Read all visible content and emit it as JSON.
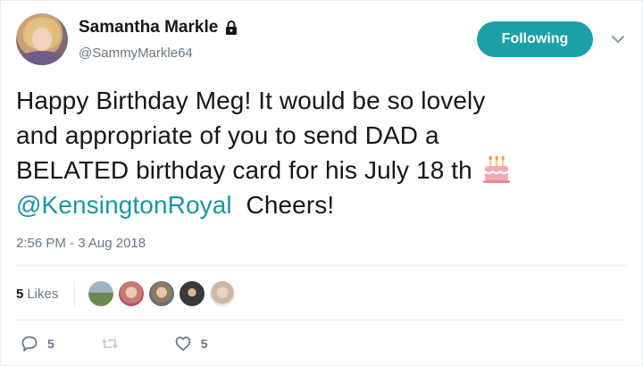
{
  "author": {
    "display_name": "Samantha Markle",
    "handle": "@SammyMarkle64",
    "protected_icon": "lock-icon"
  },
  "follow_button": {
    "label": "Following",
    "color": "#1da1a8"
  },
  "menu": {
    "icon": "chevron-down-icon"
  },
  "tweet": {
    "line1": "Happy Birthday Meg! It would be so lovely",
    "line2": "and appropriate of you to send DAD a",
    "line3": "BELATED birthday card for his July 18 th",
    "mention": "@KensingtonRoyal",
    "line4_rest": "  Cheers!",
    "emoji_icon": "birthday-cake-icon",
    "mention_color": "#1b95a5"
  },
  "timestamp": "2:56 PM - 3 Aug 2018",
  "likes": {
    "count": "5",
    "label": "Likes",
    "avatar_count": 5
  },
  "actions": {
    "reply": {
      "icon": "reply-icon",
      "count": "5"
    },
    "retweet": {
      "icon": "retweet-icon",
      "count": ""
    },
    "like": {
      "icon": "heart-icon",
      "count": "5"
    }
  }
}
